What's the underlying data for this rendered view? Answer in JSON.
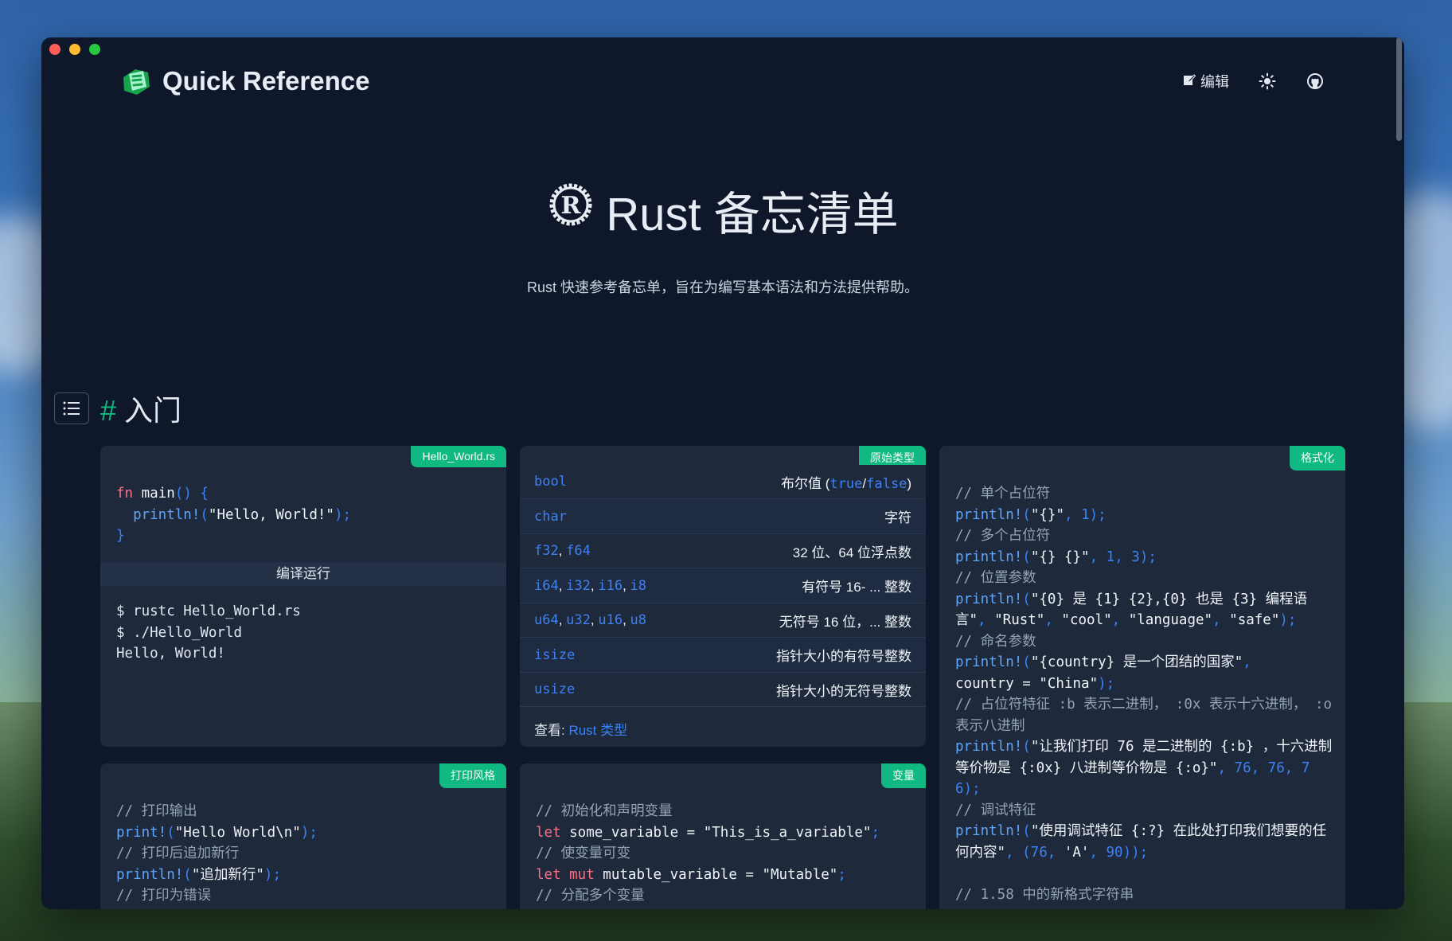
{
  "window": {
    "controls": [
      "close",
      "minimize",
      "zoom"
    ]
  },
  "nav": {
    "brand": "Quick Reference",
    "edit_label": "编辑",
    "icons": [
      "edit-icon",
      "sun-icon",
      "github-icon"
    ]
  },
  "hero": {
    "title": "Rust 备忘清单",
    "subtitle": "Rust 快速参考备忘单，旨在为编写基本语法和方法提供帮助。"
  },
  "section": {
    "hash": "#",
    "title": "入门"
  },
  "cards": {
    "hello": {
      "tag": "Hello_World.rs",
      "code": [
        "fn main() {",
        "  println!(\"Hello, World!\");",
        "}"
      ],
      "sub_header": "编译运行",
      "shell": [
        "$ rustc Hello_World.rs",
        "$ ./Hello_World",
        "Hello, World!"
      ]
    },
    "types": {
      "tag": "原始类型",
      "rows": [
        {
          "keys": [
            "bool"
          ],
          "desc": "布尔值 (",
          "desc_keys": [
            "true",
            "false"
          ],
          "desc_end": ")"
        },
        {
          "keys": [
            "char"
          ],
          "desc": "字符"
        },
        {
          "keys": [
            "f32",
            "f64"
          ],
          "desc": "32 位、64 位浮点数"
        },
        {
          "keys": [
            "i64",
            "i32",
            "i16",
            "i8"
          ],
          "desc": "有符号 16- ... 整数"
        },
        {
          "keys": [
            "u64",
            "u32",
            "u16",
            "u8"
          ],
          "desc": "无符号 16 位，... 整数"
        },
        {
          "keys": [
            "isize"
          ],
          "desc": "指针大小的有符号整数"
        },
        {
          "keys": [
            "usize"
          ],
          "desc": "指针大小的无符号整数"
        }
      ],
      "see_label": "查看: ",
      "see_link": "Rust 类型"
    },
    "format": {
      "tag": "格式化",
      "c1": "// 单个占位符",
      "l1a": "println!",
      "l1b": "(",
      "l1c": "\"{}\"",
      "l1d": ", 1);",
      "c2": "// 多个占位符",
      "l2a": "println!",
      "l2b": "(",
      "l2c": "\"{} {}\"",
      "l2d": ", 1, 3);",
      "c3": "// 位置参数",
      "l3a": "println!",
      "l3b": "(",
      "l3c": "\"{0} 是 {1} {2},{0} 也是 {3} 编程语言\"",
      "l3d": ", ",
      "l3e": "\"Rust\"",
      "l3f": ", ",
      "l3g": "\"cool\"",
      "l3h": ", ",
      "l3i": "\"language\"",
      "l3j": ", ",
      "l3k": "\"safe\"",
      "l3l": ");",
      "c4": "// 命名参数",
      "l4a": "println!",
      "l4b": "(",
      "l4c": "\"{country} 是一个团结的国家\"",
      "l4d": ",",
      "l4e": "country = ",
      "l4f": "\"China\"",
      "l4g": ");",
      "c5": "// 占位符特征 :b 表示二进制， :0x 表示十六进制， :o 表示八进制",
      "l5a": "println!",
      "l5b": "(",
      "l5c": "\"让我们打印 76 是二进制的 {:b} ，十六进制等价物是 {:0x} 八进制等价物是 {:o}\"",
      "l5d": ", 76, 76, 76);",
      "c6": "// 调试特征",
      "l6a": "println!",
      "l6b": "(",
      "l6c": "\"使用调试特征 {:?} 在此处打印我们想要的任何内容\"",
      "l6d": ", (76, ",
      "l6e": "'A'",
      "l6f": ", 90));",
      "c7": "// 1.58 中的新格式字符串"
    },
    "print": {
      "tag": "打印风格",
      "c1": "// 打印输出",
      "l1a": "print!",
      "l1b": "(",
      "l1c": "\"Hello World\\n\"",
      "l1d": ");",
      "c2": "// 打印后追加新行",
      "l2a": "println!",
      "l2b": "(",
      "l2c": "\"追加新行\"",
      "l2d": ");",
      "c3": "// 打印为错误"
    },
    "vars": {
      "tag": "变量",
      "c1": "// 初始化和声明变量",
      "l1a": "let",
      "l1b": " some_variable = ",
      "l1c": "\"This_is_a_variable\"",
      "l1d": ";",
      "c2": "// 使变量可变",
      "l2a": "let mut",
      "l2b": " mutable_variable = ",
      "l2c": "\"Mutable\"",
      "l2d": ";",
      "c3": "// 分配多个变量"
    }
  }
}
